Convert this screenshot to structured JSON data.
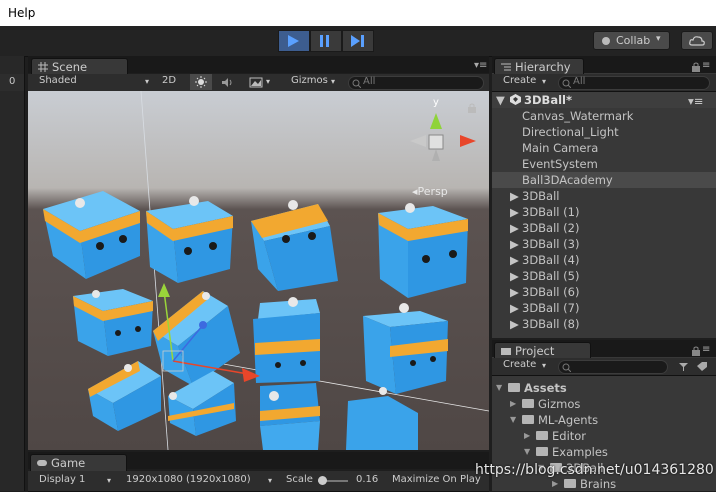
{
  "menu": {
    "help": "Help"
  },
  "toolbar": {
    "collab_label": "Collab",
    "collab_caret": "▾"
  },
  "left_panel": {
    "value": "0"
  },
  "scene": {
    "tab_label": "Scene",
    "shading_mode": "Shaded",
    "mode_2d": "2D",
    "gizmos_label": "Gizmos",
    "search_placeholder": "All",
    "persp_label": "Persp",
    "gizmo_axis_y": "y"
  },
  "hierarchy": {
    "tab_label": "Hierarchy",
    "create_label": "Create",
    "search_placeholder": "All",
    "scene_name": "3DBall*",
    "items": [
      "Canvas_Watermark",
      "Directional_Light",
      "Main Camera",
      "EventSystem",
      "Ball3DAcademy",
      "3DBall",
      "3DBall (1)",
      "3DBall (2)",
      "3DBall (3)",
      "3DBall (4)",
      "3DBall (5)",
      "3DBall (6)",
      "3DBall (7)",
      "3DBall (8)"
    ],
    "selected": "Ball3DAcademy"
  },
  "project": {
    "tab_label": "Project",
    "create_label": "Create",
    "tree": [
      "Assets",
      "Gizmos",
      "ML-Agents",
      "Editor",
      "Examples",
      "3DBall",
      "Brains"
    ]
  },
  "game": {
    "tab_label": "Game",
    "display": "Display 1",
    "resolution": "1920x1080 (1920x1080)",
    "scale_label": "Scale",
    "scale_value": "0.16",
    "maximize": "Maximize On Play"
  },
  "watermark": "https://blog.csdn.net/u014361280",
  "colors": {
    "cube_blue": "#41a9ee",
    "cube_stripe": "#f2a830",
    "play_active": "#3d5d8f",
    "selected_row": "#4a4a4a"
  }
}
